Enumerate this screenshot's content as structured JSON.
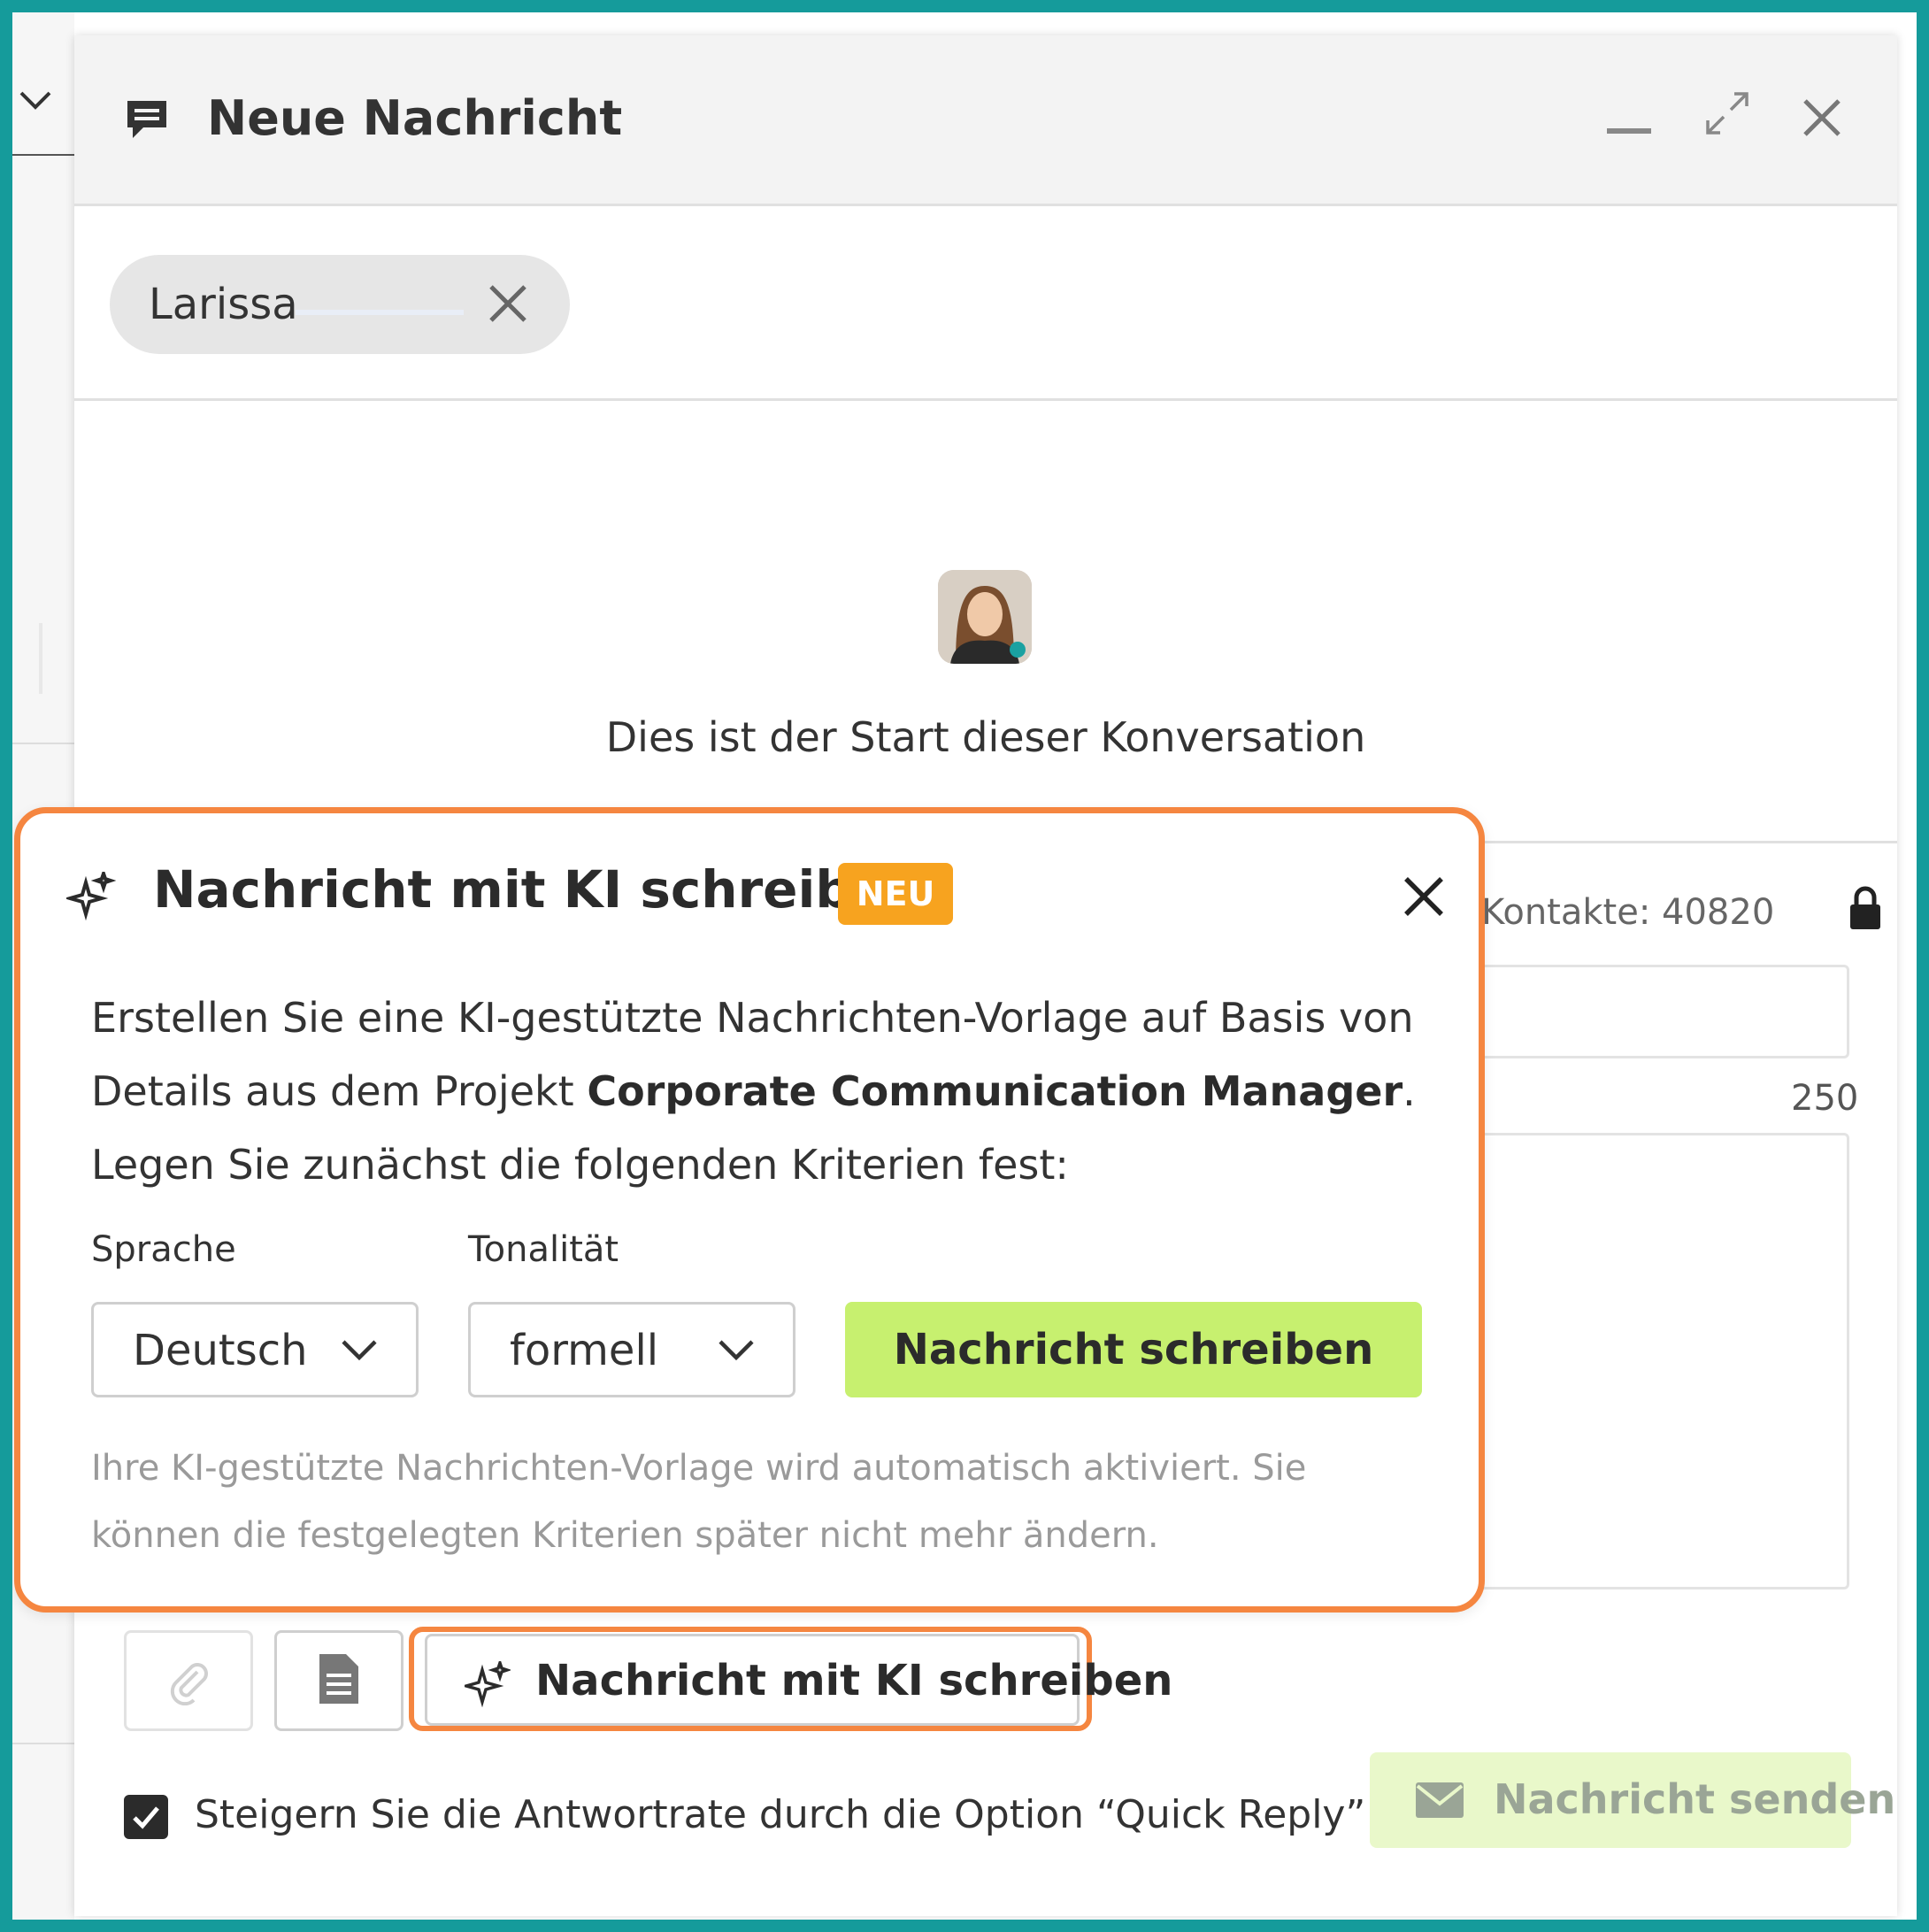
{
  "background": {
    "left_chevron_icon": "chevron-down-icon"
  },
  "dialog": {
    "title": "Neue Nachricht",
    "icons": {
      "title": "chat-bubble-icon",
      "minimize": "minimize-icon",
      "expand": "expand-icon",
      "close": "close-icon"
    }
  },
  "recipient": {
    "name": "Larissa",
    "remove_icon": "close-icon"
  },
  "conversation": {
    "start_text": "Dies ist der Start dieser Konversation"
  },
  "compose": {
    "contacts_text": "t-Kontakte: 40820",
    "char_count": "250",
    "lock_icon": "lock-icon"
  },
  "toolbar": {
    "attach_icon": "paperclip-icon",
    "template_icon": "document-icon",
    "ai_button_label": "Nachricht mit KI schreiben",
    "ai_icon": "sparkles-icon"
  },
  "footer": {
    "quick_reply_checked": true,
    "quick_reply_text": "Steigern Sie die Antwortrate durch die Option “Quick Reply”",
    "send_label": "Nachricht senden",
    "send_icon": "envelope-icon"
  },
  "ai_popover": {
    "title": "Nachricht mit KI schreiben",
    "badge": "NEU",
    "description_before": "Erstellen Sie eine KI-gestützte Nachrichten-Vorlage auf Basis von Details aus dem Projekt ",
    "description_project": "Corporate Communication Manager",
    "description_after": ". Legen Sie zunächst die folgenden Kriterien fest:",
    "language_label": "Sprache",
    "language_value": "Deutsch",
    "tone_label": "Tonalität",
    "tone_value": "formell",
    "write_button": "Nachricht schreiben",
    "note": "Ihre KI-gestützte Nachrichten-Vorlage wird automatisch aktiviert. Sie können die festgelegten Kriterien später nicht mehr ändern."
  },
  "colors": {
    "frame": "#159b9b",
    "highlight": "#f58640",
    "badge": "#f7a31f",
    "write_button": "#c7f06f",
    "send_button_disabled": "#e9f8ca"
  }
}
